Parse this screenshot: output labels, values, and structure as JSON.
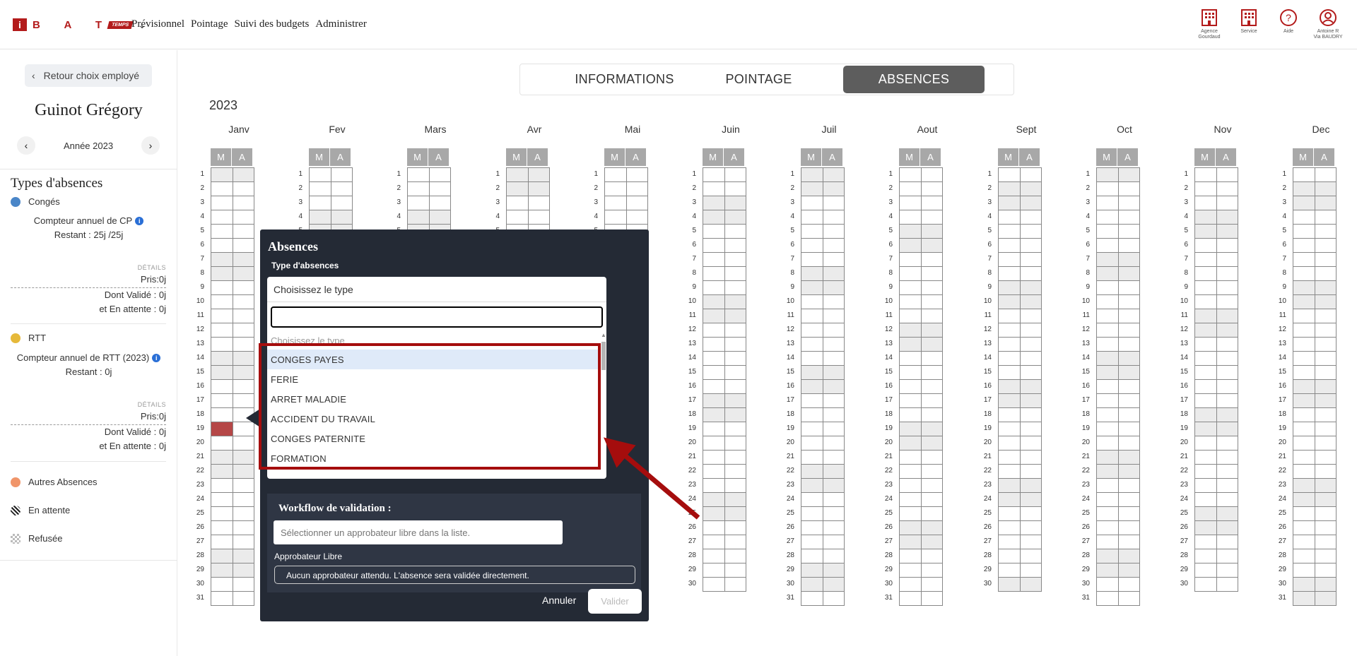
{
  "header": {
    "logo_letters": "B A T",
    "logo_i": "i",
    "logo_tag": "TEMPS",
    "nav": [
      "Prévisionnel",
      "Pointage",
      "Suivi des budgets",
      "Administrer"
    ],
    "right_items": [
      {
        "icon": "building-icon",
        "label": "Agence Gourdaud"
      },
      {
        "icon": "building-icon",
        "label": "Service"
      },
      {
        "icon": "help-icon",
        "label": "Aide"
      },
      {
        "icon": "user-icon",
        "label": "Antoine R Via BAUDRY"
      }
    ]
  },
  "sidebar": {
    "back_label": "Retour choix employé",
    "employee_name": "Guinot Grégory",
    "year_label": "Année 2023",
    "types_title": "Types d'absences",
    "conges": {
      "label": "Congés",
      "color": "#4a86c8",
      "counter": "Compteur annuel de CP",
      "remaining": "Restant : 25j /25j",
      "details": "DÉTAILS",
      "pris": "Pris:0j",
      "valide": "Dont Validé : 0j",
      "attente": "et En attente : 0j"
    },
    "rtt": {
      "label": "RTT",
      "color": "#e6b93a",
      "counter": "Compteur annuel de RTT (2023)",
      "remaining": "Restant : 0j",
      "details": "DÉTAILS",
      "pris": "Pris:0j",
      "valide": "Dont Validé : 0j",
      "attente": "et En attente : 0j"
    },
    "autres": {
      "label": "Autres Absences",
      "color": "#f0956a"
    },
    "en_attente": {
      "label": "En attente"
    },
    "refusee": {
      "label": "Refusée"
    }
  },
  "tabs": [
    {
      "label": "INFORMATIONS",
      "active": false
    },
    {
      "label": "POINTAGE",
      "active": false
    },
    {
      "label": "ABSENCES",
      "active": true
    }
  ],
  "calendar": {
    "year": "2023",
    "half_labels": [
      "M",
      "A"
    ],
    "months": [
      {
        "name": "Janv",
        "days": 31
      },
      {
        "name": "Fev",
        "days": 28
      },
      {
        "name": "Mars",
        "days": 31
      },
      {
        "name": "Avr",
        "days": 30
      },
      {
        "name": "Mai",
        "days": 31
      },
      {
        "name": "Juin",
        "days": 30
      },
      {
        "name": "Juil",
        "days": 31
      },
      {
        "name": "Aout",
        "days": 31
      },
      {
        "name": "Sept",
        "days": 30
      },
      {
        "name": "Oct",
        "days": 31
      },
      {
        "name": "Nov",
        "days": 30
      },
      {
        "name": "Dec",
        "days": 31
      }
    ],
    "absence_marked": {
      "month": "Janv",
      "day": 19,
      "half": "M"
    }
  },
  "modal": {
    "title": "Absences",
    "type_label": "Type d'absences",
    "select_current": "Choisissez le type",
    "search_value": "",
    "placeholder_option": "Choisissez le type",
    "options": [
      "CONGES PAYES",
      "FERIE",
      "ARRET MALADIE",
      "ACCIDENT DU TRAVAIL",
      "CONGES PATERNITE",
      "FORMATION"
    ],
    "highlighted_option": "CONGES PAYES",
    "workflow_title": "Workflow de validation :",
    "approver_placeholder": "Sélectionner un approbateur libre dans la liste.",
    "approver_label": "Approbateur Libre",
    "note": "Aucun approbateur attendu. L'absence sera validée directement.",
    "cancel_label": "Annuler",
    "validate_label": "Valider"
  },
  "colors": {
    "brand": "#b31b1b",
    "modal_bg": "#242a35",
    "annotation": "#a50d0d"
  }
}
